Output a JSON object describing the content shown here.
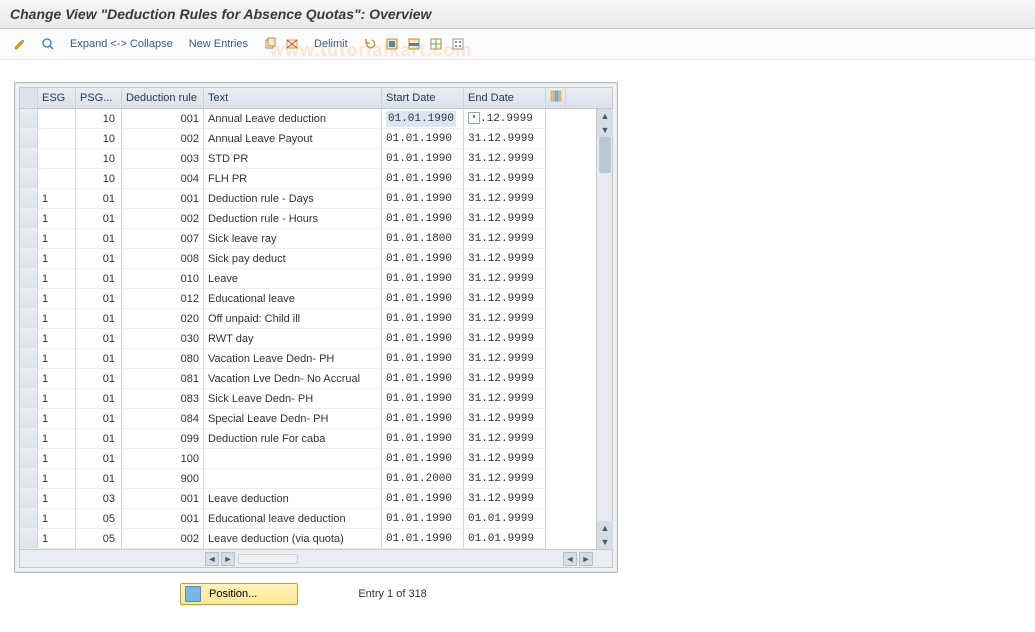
{
  "header": {
    "title": "Change View \"Deduction Rules for Absence Quotas\": Overview"
  },
  "toolbar": {
    "expand_collapse": "Expand <-> Collapse",
    "new_entries": "New Entries",
    "delimit": "Delimit"
  },
  "columns": {
    "esg": "ESG",
    "psg": "PSG...",
    "rule": "Deduction rule",
    "text": "Text",
    "start": "Start Date",
    "end": "End Date"
  },
  "rows": [
    {
      "esg": "",
      "psg": "10",
      "rule": "001",
      "text": "Annual Leave deduction",
      "start": "01.01.1990",
      "end": ".12.9999"
    },
    {
      "esg": "",
      "psg": "10",
      "rule": "002",
      "text": "Annual Leave Payout",
      "start": "01.01.1990",
      "end": "31.12.9999"
    },
    {
      "esg": "",
      "psg": "10",
      "rule": "003",
      "text": "STD PR",
      "start": "01.01.1990",
      "end": "31.12.9999"
    },
    {
      "esg": "",
      "psg": "10",
      "rule": "004",
      "text": "FLH PR",
      "start": "01.01.1990",
      "end": "31.12.9999"
    },
    {
      "esg": "1",
      "psg": "01",
      "rule": "001",
      "text": "Deduction rule - Days",
      "start": "01.01.1990",
      "end": "31.12.9999"
    },
    {
      "esg": "1",
      "psg": "01",
      "rule": "002",
      "text": "Deduction rule - Hours",
      "start": "01.01.1990",
      "end": "31.12.9999"
    },
    {
      "esg": "1",
      "psg": "01",
      "rule": "007",
      "text": "Sick leave ray",
      "start": "01.01.1800",
      "end": "31.12.9999"
    },
    {
      "esg": "1",
      "psg": "01",
      "rule": "008",
      "text": "Sick pay deduct",
      "start": "01.01.1990",
      "end": "31.12.9999"
    },
    {
      "esg": "1",
      "psg": "01",
      "rule": "010",
      "text": "Leave",
      "start": "01.01.1990",
      "end": "31.12.9999"
    },
    {
      "esg": "1",
      "psg": "01",
      "rule": "012",
      "text": "Educational leave",
      "start": "01.01.1990",
      "end": "31.12.9999"
    },
    {
      "esg": "1",
      "psg": "01",
      "rule": "020",
      "text": "Off unpaid: Child ill",
      "start": "01.01.1990",
      "end": "31.12.9999"
    },
    {
      "esg": "1",
      "psg": "01",
      "rule": "030",
      "text": "RWT day",
      "start": "01.01.1990",
      "end": "31.12.9999"
    },
    {
      "esg": "1",
      "psg": "01",
      "rule": "080",
      "text": "Vacation Leave Dedn- PH",
      "start": "01.01.1990",
      "end": "31.12.9999"
    },
    {
      "esg": "1",
      "psg": "01",
      "rule": "081",
      "text": "Vacation Lve Dedn- No Accrual",
      "start": "01.01.1990",
      "end": "31.12.9999"
    },
    {
      "esg": "1",
      "psg": "01",
      "rule": "083",
      "text": "Sick Leave Dedn- PH",
      "start": "01.01.1990",
      "end": "31.12.9999"
    },
    {
      "esg": "1",
      "psg": "01",
      "rule": "084",
      "text": "Special Leave Dedn- PH",
      "start": "01.01.1990",
      "end": "31.12.9999"
    },
    {
      "esg": "1",
      "psg": "01",
      "rule": "099",
      "text": "Deduction rule For caba",
      "start": "01.01.1990",
      "end": "31.12.9999"
    },
    {
      "esg": "1",
      "psg": "01",
      "rule": "100",
      "text": "",
      "start": "01.01.1990",
      "end": "31.12.9999"
    },
    {
      "esg": "1",
      "psg": "01",
      "rule": "900",
      "text": "",
      "start": "01.01.2000",
      "end": "31.12.9999"
    },
    {
      "esg": "1",
      "psg": "03",
      "rule": "001",
      "text": "Leave deduction",
      "start": "01.01.1990",
      "end": "31.12.9999"
    },
    {
      "esg": "1",
      "psg": "05",
      "rule": "001",
      "text": "Educational leave deduction",
      "start": "01.01.1990",
      "end": "01.01.9999"
    },
    {
      "esg": "1",
      "psg": "05",
      "rule": "002",
      "text": "Leave deduction (via quota)",
      "start": "01.01.1990",
      "end": "01.01.9999"
    }
  ],
  "footer": {
    "position_label": "Position...",
    "entry_text": "Entry 1 of 318"
  },
  "watermark": "www.tutorialkart.com"
}
